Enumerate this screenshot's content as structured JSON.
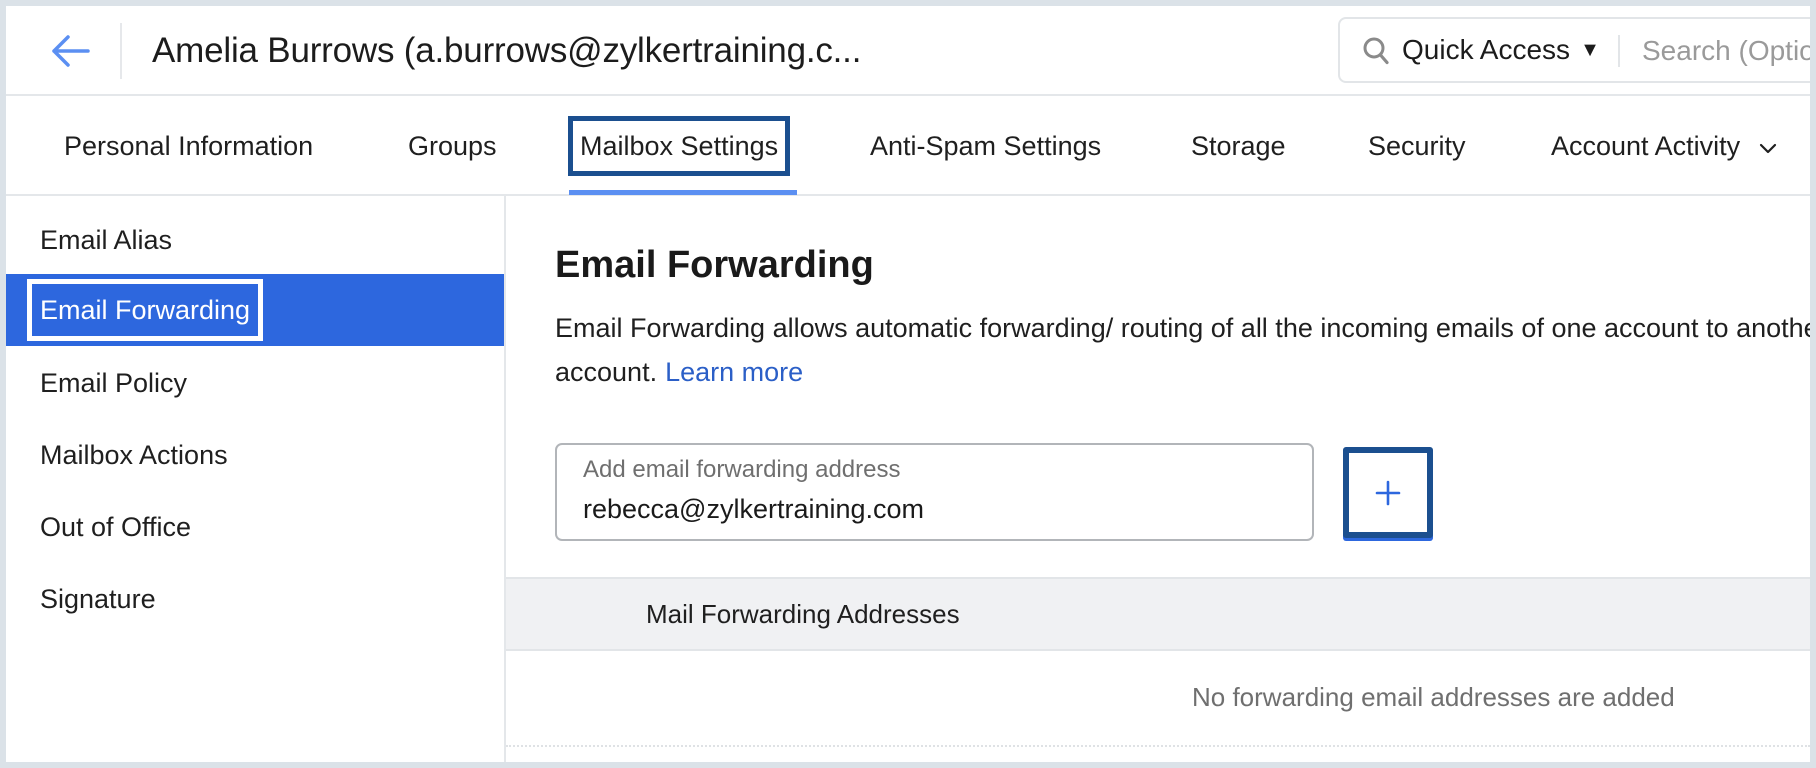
{
  "header": {
    "back_icon": "arrow-left-icon",
    "title": "Amelia Burrows (a.burrows@zylkertraining.c...",
    "search": {
      "icon": "search-icon",
      "quick_access_label": "Quick Access",
      "quick_access_caret": "▼",
      "placeholder": "Search (Options)"
    }
  },
  "tabs": [
    {
      "label": "Personal Information",
      "active": false
    },
    {
      "label": "Groups",
      "active": false
    },
    {
      "label": "Mailbox Settings",
      "active": true
    },
    {
      "label": "Anti-Spam Settings",
      "active": false
    },
    {
      "label": "Storage",
      "active": false
    },
    {
      "label": "Security",
      "active": false
    },
    {
      "label": "Account Activity",
      "active": false,
      "icon": "chevron-down-icon"
    }
  ],
  "sidebar": {
    "items": [
      {
        "label": "Email Alias",
        "active": false
      },
      {
        "label": "Email Forwarding",
        "active": true
      },
      {
        "label": "Email Policy",
        "active": false
      },
      {
        "label": "Mailbox Actions",
        "active": false
      },
      {
        "label": "Out of Office",
        "active": false
      },
      {
        "label": "Signature",
        "active": false
      }
    ]
  },
  "main": {
    "heading": "Email Forwarding",
    "description": "Email Forwarding allows automatic forwarding/ routing of all the incoming emails of one account to another account.",
    "learn_more": "Learn more",
    "input": {
      "label": "Add email forwarding address",
      "value": "rebecca@zylkertraining.com"
    },
    "add_button_icon": "plus-icon",
    "table": {
      "column_header": "Mail Forwarding Addresses",
      "empty_message": "No forwarding email addresses are added"
    }
  },
  "colors": {
    "accent": "#2d67de",
    "focus_outline": "#1b4f8f",
    "link": "#2b5fc7",
    "tab_underline": "#5b8ff2",
    "back_arrow": "#5b8ff2"
  }
}
